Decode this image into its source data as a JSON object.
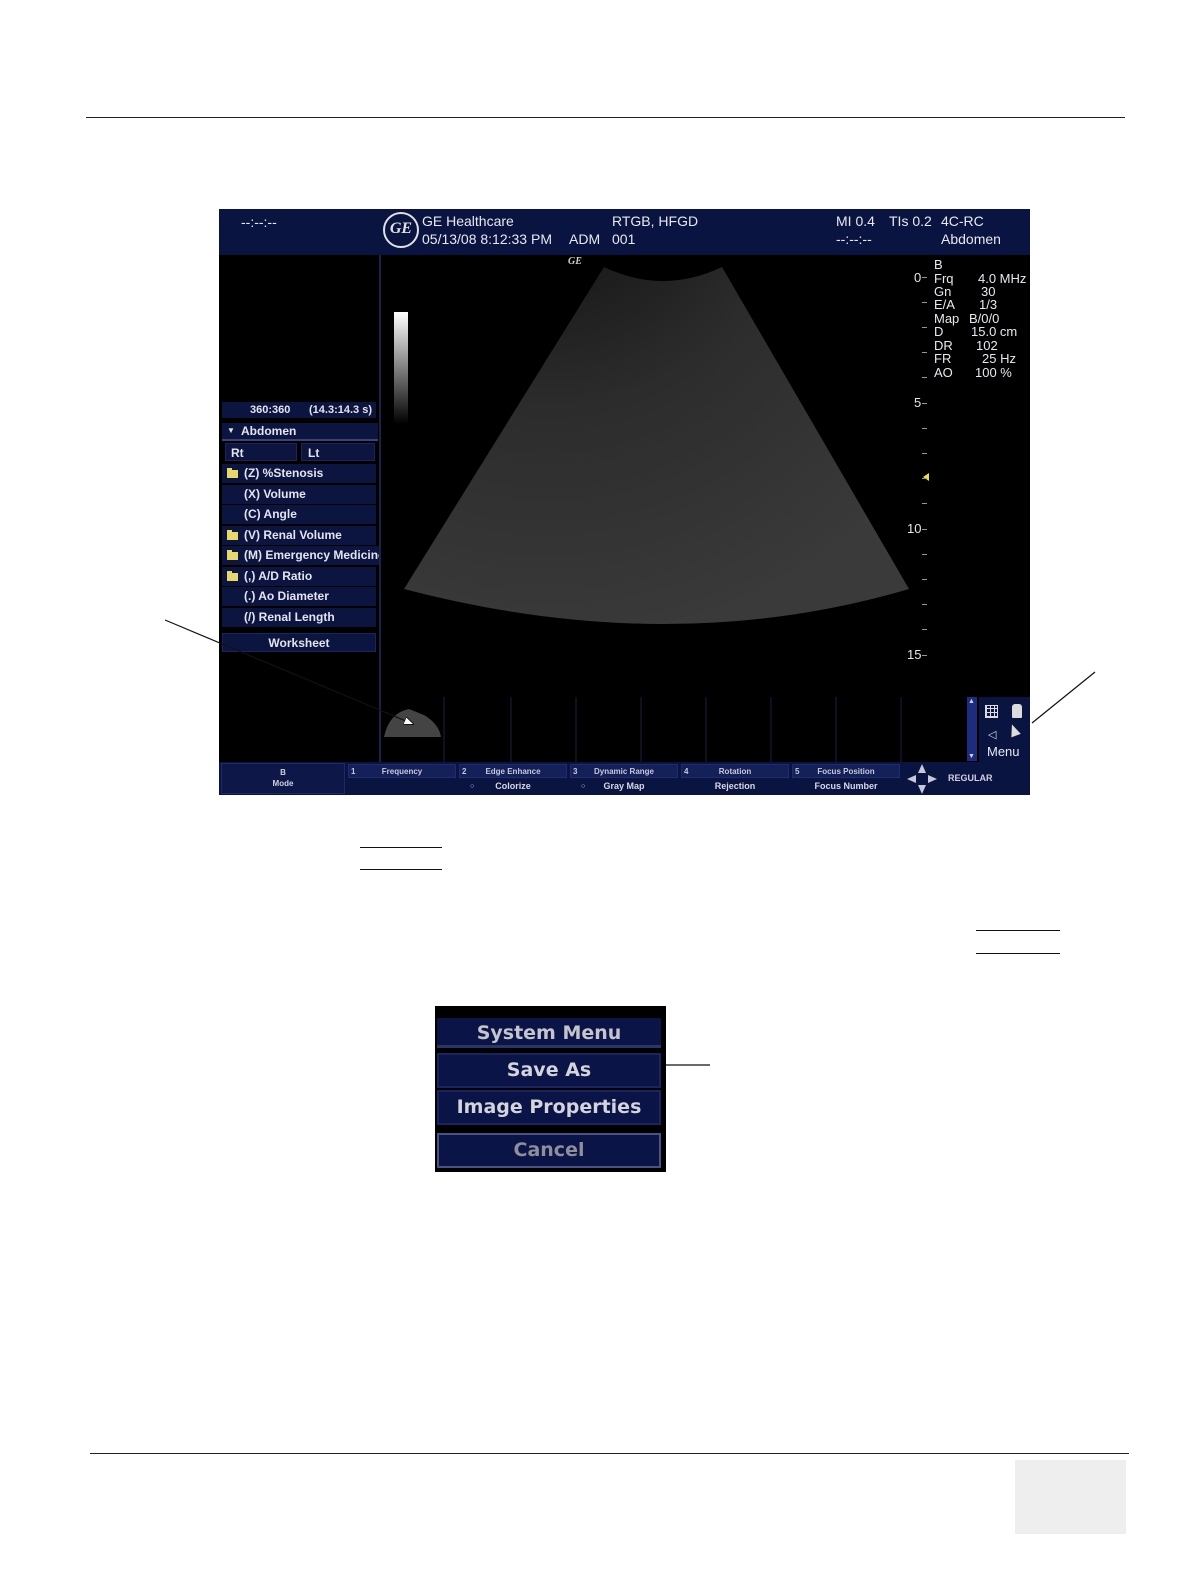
{
  "topbar": {
    "left_time": "--:--:--",
    "brand": "GE Healthcare",
    "datetime": "05/13/08 8:12:33 PM",
    "operator": "ADM",
    "patient_name": "RTGB, HFGD",
    "patient_id": "001",
    "mi": "MI 0.4",
    "tis": "TIs 0.2",
    "probe": "4C-RC",
    "time2": "--:--:--",
    "preset": "Abdomen",
    "logo_text": "GE"
  },
  "image_area": {
    "mini_logo": "GE",
    "cine_counter": "360:360",
    "cine_time": "(14.3:14.3 s)"
  },
  "measurements": {
    "category": "Abdomen",
    "side_left": "Rt",
    "side_right": "Lt",
    "items": [
      {
        "label": "(Z)  %Stenosis",
        "folder": true
      },
      {
        "label": "(X)  Volume",
        "folder": false
      },
      {
        "label": "(C)  Angle",
        "folder": false
      },
      {
        "label": "(V)  Renal Volume",
        "folder": true
      },
      {
        "label": "(M)  Emergency Medicine",
        "folder": true
      },
      {
        "label": "(,)  A/D Ratio",
        "folder": true
      },
      {
        "label": "(.)  Ao Diameter",
        "folder": false
      },
      {
        "label": "(/)  Renal Length",
        "folder": false
      }
    ],
    "worksheet": "Worksheet"
  },
  "params": {
    "mode": "B",
    "rows": [
      {
        "key": "Frq",
        "value": "4.0 MHz"
      },
      {
        "key": "Gn",
        "value": "30"
      },
      {
        "key": "E/A",
        "value": "1/3"
      },
      {
        "key": "Map",
        "value": "B/0/0"
      },
      {
        "key": "D",
        "value": "15.0 cm"
      },
      {
        "key": "DR",
        "value": "102"
      },
      {
        "key": "FR",
        "value": "25 Hz"
      },
      {
        "key": "AO",
        "value": "100 %"
      }
    ]
  },
  "depth_scale": [
    "0",
    "5",
    "10",
    "15"
  ],
  "side_menu": {
    "label": "Menu"
  },
  "softkeys": {
    "mode_line1": "B",
    "mode_line2": "Mode",
    "top": [
      "Frequency",
      "Edge Enhance",
      "Dynamic Range",
      "Rotation",
      "Focus Position"
    ],
    "top_nums": [
      "1",
      "2",
      "3",
      "4",
      "5"
    ],
    "bottom": [
      "",
      "Colorize",
      "Gray Map",
      "Rejection",
      "Focus Number"
    ],
    "status": "REGULAR"
  },
  "system_menu": {
    "title": "System Menu",
    "items": [
      "Save As",
      "Image Properties"
    ],
    "cancel": "Cancel"
  }
}
